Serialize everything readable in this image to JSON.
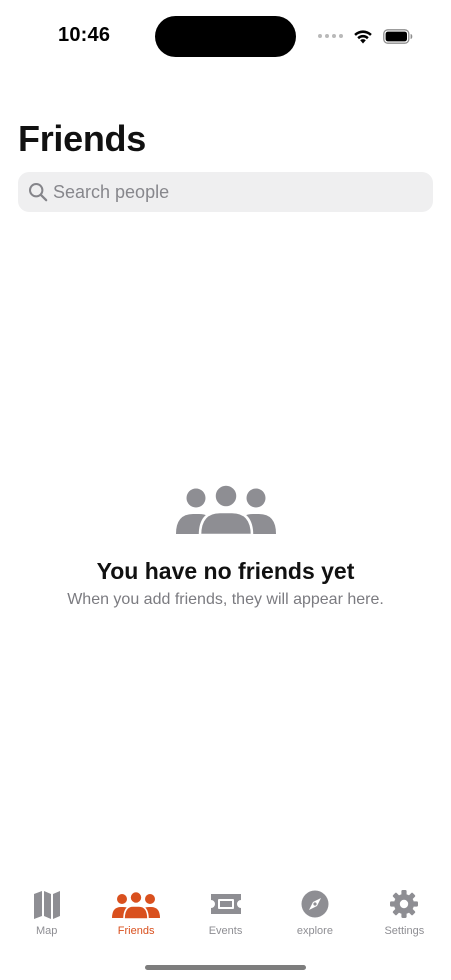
{
  "status_bar": {
    "time": "10:46"
  },
  "page": {
    "title": "Friends"
  },
  "search": {
    "placeholder": "Search people",
    "value": "",
    "icon": "magnifying-glass-icon"
  },
  "empty_state": {
    "icon": "people-group-icon",
    "title": "You have no friends yet",
    "subtitle": "When you add friends, they will appear here."
  },
  "tab_bar": {
    "active_color": "#d9501e",
    "inactive_color": "#8e8e93",
    "items": [
      {
        "label": "Map",
        "icon": "map-icon",
        "active": false
      },
      {
        "label": "Friends",
        "icon": "people-group-icon",
        "active": true
      },
      {
        "label": "Events",
        "icon": "ticket-icon",
        "active": false
      },
      {
        "label": "explore",
        "icon": "compass-icon",
        "active": false
      },
      {
        "label": "Settings",
        "icon": "gear-icon",
        "active": false
      }
    ]
  }
}
